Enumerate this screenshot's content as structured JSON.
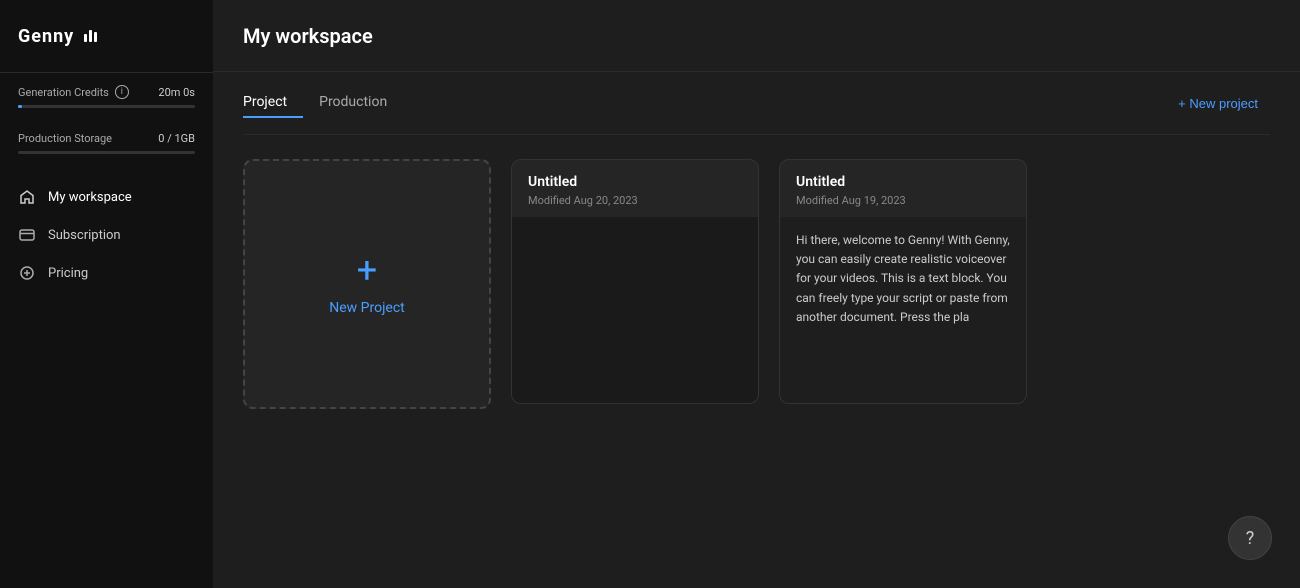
{
  "app": {
    "name": "Genny",
    "logo_symbol": "|||"
  },
  "sidebar": {
    "credits": {
      "label": "Generation Credits",
      "value": "20m 0s",
      "progress_percent": 2
    },
    "storage": {
      "label": "Production Storage",
      "value": "0 / 1GB",
      "progress_percent": 0
    },
    "nav_items": [
      {
        "id": "workspace",
        "label": "My workspace",
        "icon": "home-icon",
        "active": true
      },
      {
        "id": "subscription",
        "label": "Subscription",
        "icon": "card-icon",
        "active": false
      },
      {
        "id": "pricing",
        "label": "Pricing",
        "icon": "tag-icon",
        "active": false
      }
    ]
  },
  "main": {
    "title": "My workspace",
    "tabs": [
      {
        "id": "project",
        "label": "Project",
        "active": true
      },
      {
        "id": "production",
        "label": "Production",
        "active": false
      }
    ],
    "new_project_button": "+ New project",
    "projects": [
      {
        "id": "new",
        "type": "new",
        "label": "New Project"
      },
      {
        "id": "untitled-1",
        "type": "empty",
        "title": "Untitled",
        "modified": "Modified Aug 20, 2023"
      },
      {
        "id": "untitled-2",
        "type": "text",
        "title": "Untitled",
        "modified": "Modified Aug 19, 2023",
        "preview_text": "Hi there, welcome to Genny! With Genny, you can easily create realistic voiceover for your videos. This is a text block. You can freely type your script or paste from another document. Press the pla"
      }
    ]
  },
  "help": {
    "icon": "?"
  }
}
